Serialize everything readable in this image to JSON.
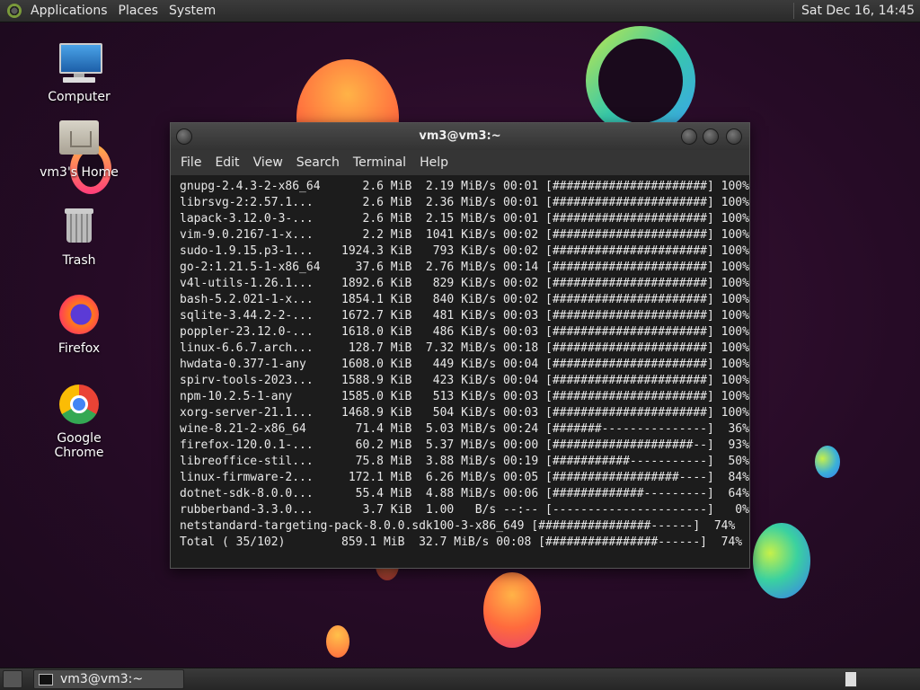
{
  "top_panel": {
    "menus": [
      "Applications",
      "Places",
      "System"
    ],
    "clock": "Sat Dec 16, 14:45"
  },
  "desktop": {
    "icons": [
      {
        "label": "Computer",
        "icon": "computer-icon"
      },
      {
        "label": "vm3's Home",
        "icon": "home-folder-icon"
      },
      {
        "label": "Trash",
        "icon": "trash-icon"
      },
      {
        "label": "Firefox",
        "icon": "firefox-icon"
      },
      {
        "label": "Google Chrome",
        "icon": "chrome-icon"
      }
    ]
  },
  "terminal": {
    "title": "vm3@vm3:~",
    "menu": [
      "File",
      "Edit",
      "View",
      "Search",
      "Terminal",
      "Help"
    ],
    "lines": [
      "gnupg-2.4.3-2-x86_64      2.6 MiB  2.19 MiB/s 00:01 [######################] 100%",
      "librsvg-2:2.57.1...       2.6 MiB  2.36 MiB/s 00:01 [######################] 100%",
      "lapack-3.12.0-3-...       2.6 MiB  2.15 MiB/s 00:01 [######################] 100%",
      "vim-9.0.2167-1-x...       2.2 MiB  1041 KiB/s 00:02 [######################] 100%",
      "sudo-1.9.15.p3-1...    1924.3 KiB   793 KiB/s 00:02 [######################] 100%",
      "go-2:1.21.5-1-x86_64     37.6 MiB  2.76 MiB/s 00:14 [######################] 100%",
      "v4l-utils-1.26.1...    1892.6 KiB   829 KiB/s 00:02 [######################] 100%",
      "bash-5.2.021-1-x...    1854.1 KiB   840 KiB/s 00:02 [######################] 100%",
      "sqlite-3.44.2-2-...    1672.7 KiB   481 KiB/s 00:03 [######################] 100%",
      "poppler-23.12.0-...    1618.0 KiB   486 KiB/s 00:03 [######################] 100%",
      "linux-6.6.7.arch...     128.7 MiB  7.32 MiB/s 00:18 [######################] 100%",
      "hwdata-0.377-1-any     1608.0 KiB   449 KiB/s 00:04 [######################] 100%",
      "spirv-tools-2023...    1588.9 KiB   423 KiB/s 00:04 [######################] 100%",
      "npm-10.2.5-1-any       1585.0 KiB   513 KiB/s 00:03 [######################] 100%",
      "xorg-server-21.1...    1468.9 KiB   504 KiB/s 00:03 [######################] 100%",
      "wine-8.21-2-x86_64       71.4 MiB  5.03 MiB/s 00:24 [#######---------------]  36%",
      "firefox-120.0.1-...      60.2 MiB  5.37 MiB/s 00:00 [####################--]  93%",
      "libreoffice-stil...      75.8 MiB  3.88 MiB/s 00:19 [###########-----------]  50%",
      "linux-firmware-2...     172.1 MiB  6.26 MiB/s 00:05 [##################----]  84%",
      "dotnet-sdk-8.0.0...      55.4 MiB  4.88 MiB/s 00:06 [#############---------]  64%",
      "rubberband-3.3.0...       3.7 KiB  1.00   B/s --:-- [----------------------]   0%",
      "netstandard-targeting-pack-8.0.0.sdk100-3-x86_649 [################------]  74%",
      "Total ( 35/102)        859.1 MiB  32.7 MiB/s 00:08 [################------]  74%"
    ]
  },
  "taskbar": {
    "task_label": "vm3@vm3:~"
  }
}
